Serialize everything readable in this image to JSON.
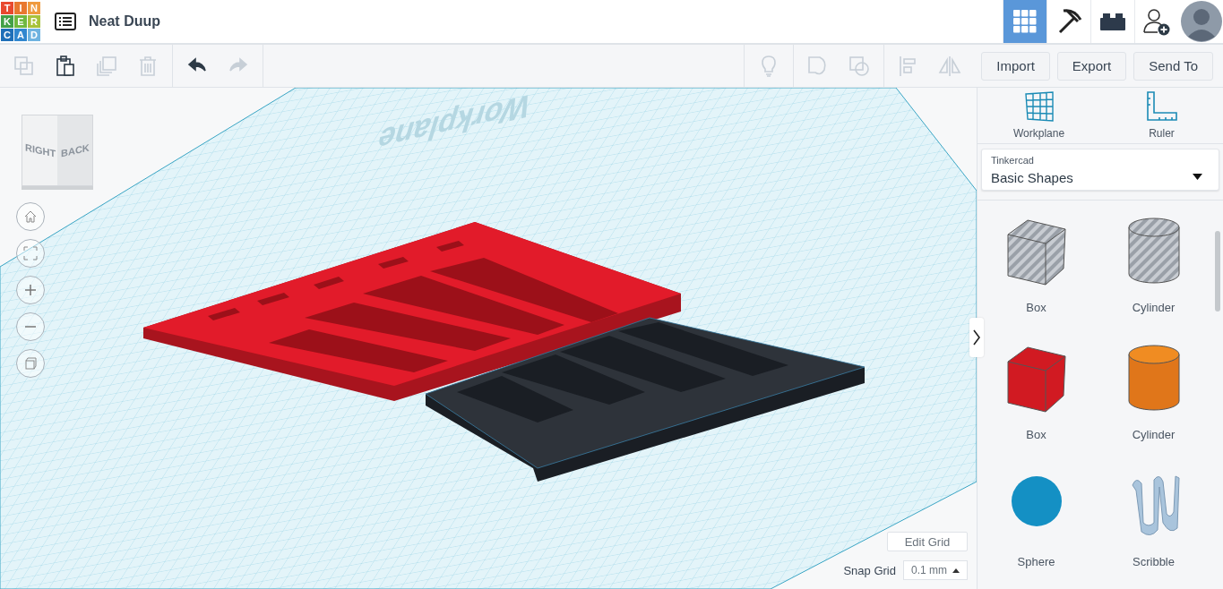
{
  "logo": {
    "letters": [
      {
        "char": "T",
        "color": "#e8492f"
      },
      {
        "char": "I",
        "color": "#e8782f"
      },
      {
        "char": "N",
        "color": "#ef9a3e"
      },
      {
        "char": "K",
        "color": "#43a047"
      },
      {
        "char": "E",
        "color": "#6fb83f"
      },
      {
        "char": "R",
        "color": "#a7c23b"
      },
      {
        "char": "C",
        "color": "#1f6fb8"
      },
      {
        "char": "A",
        "color": "#3187cf"
      },
      {
        "char": "D",
        "color": "#6fb3e0"
      }
    ]
  },
  "design_title": "Neat Duup",
  "view_modes": [
    {
      "kind": "grid",
      "selected": true
    },
    {
      "kind": "pickaxe",
      "selected": false
    },
    {
      "kind": "bricks",
      "selected": false
    }
  ],
  "toolbar": {
    "groups": [
      [
        {
          "kind": "copy",
          "disabled": true
        },
        {
          "kind": "paste",
          "disabled": false
        },
        {
          "kind": "duplicate",
          "disabled": true
        },
        {
          "kind": "delete",
          "disabled": true
        }
      ],
      [
        {
          "kind": "undo",
          "disabled": false
        },
        {
          "kind": "redo",
          "disabled": true
        }
      ],
      [
        {
          "kind": "note",
          "disabled": true
        }
      ],
      [
        {
          "kind": "group",
          "disabled": true
        },
        {
          "kind": "ungroup",
          "disabled": true
        }
      ],
      [
        {
          "kind": "align",
          "disabled": true
        },
        {
          "kind": "mirror",
          "disabled": true
        }
      ]
    ],
    "buttons": [
      "Import",
      "Export",
      "Send To"
    ]
  },
  "viewport": {
    "workplane_label": "Workplane",
    "view_cube": {
      "left_face": "RIGHT",
      "right_face": "BACK"
    },
    "edit_grid_button": "Edit Grid",
    "snap_grid": {
      "label": "Snap Grid",
      "value": "0.1 mm"
    }
  },
  "sidebar": {
    "tools": [
      {
        "kind": "workplane",
        "label": "Workplane"
      },
      {
        "kind": "ruler",
        "label": "Ruler"
      }
    ],
    "library": {
      "source": "Tinkercad",
      "category": "Basic Shapes"
    },
    "shapes": [
      {
        "kind": "box-hole",
        "name": "Box"
      },
      {
        "kind": "cylinder-hole",
        "name": "Cylinder"
      },
      {
        "kind": "box",
        "name": "Box"
      },
      {
        "kind": "cylinder",
        "name": "Cylinder"
      },
      {
        "kind": "sphere",
        "name": "Sphere"
      },
      {
        "kind": "scribble",
        "name": "Scribble"
      }
    ]
  }
}
